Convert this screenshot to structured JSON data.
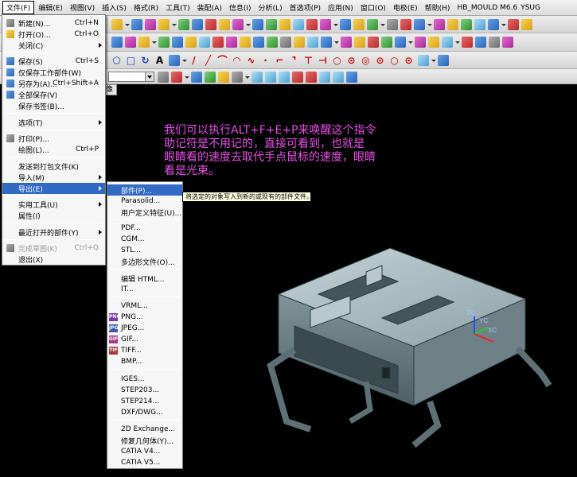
{
  "menubar": {
    "items": [
      "文件(F)",
      "编辑(E)",
      "视图(V)",
      "插入(S)",
      "格式(R)",
      "工具(T)",
      "装配(A)",
      "信息(I)",
      "分析(L)",
      "首选项(P)",
      "应用(N)",
      "窗口(O)",
      "电极(E)",
      "帮助(H)"
    ],
    "brand": "HB_MOULD M6.6",
    "brand2": "YSUG"
  },
  "viewport_tab": "像",
  "file_menu": {
    "items": [
      {
        "label": "新建(N)...",
        "shortcut": "Ctrl+N",
        "icon": "new-file-icon"
      },
      {
        "label": "打开(O)...",
        "shortcut": "Ctrl+O",
        "icon": "open-folder-icon"
      },
      {
        "label": "关闭(C)",
        "shortcut": "",
        "icon": ""
      },
      {
        "label": "保存(S)",
        "shortcut": "Ctrl+S",
        "icon": "save-icon"
      },
      {
        "label": "仅保存工作部件(W)",
        "shortcut": "",
        "icon": "save-work-part-icon"
      },
      {
        "label": "另存为(A)...",
        "shortcut": "Ctrl+Shift+A",
        "icon": "save-as-icon"
      },
      {
        "label": "全部保存(V)",
        "shortcut": "",
        "icon": "save-all-icon"
      },
      {
        "label": "保存书签(B)...",
        "shortcut": "",
        "icon": ""
      },
      {
        "label": "选项(T)",
        "shortcut": "",
        "icon": ""
      },
      {
        "label": "打印(P)...",
        "shortcut": "",
        "icon": "print-icon"
      },
      {
        "label": "绘图(L)...",
        "shortcut": "Ctrl+P",
        "icon": ""
      },
      {
        "label": "发送到打包文件(K)",
        "shortcut": "",
        "icon": ""
      },
      {
        "label": "导入(M)",
        "shortcut": "",
        "icon": ""
      },
      {
        "label": "导出(E)",
        "shortcut": "",
        "icon": ""
      },
      {
        "label": "实用工具(U)",
        "shortcut": "",
        "icon": ""
      },
      {
        "label": "属性(I)",
        "shortcut": "",
        "icon": ""
      },
      {
        "label": "最近打开的部件(Y)",
        "shortcut": "",
        "icon": ""
      },
      {
        "label": "完成草图(K)",
        "shortcut": "Ctrl+Q",
        "icon": "finish-sketch-icon"
      },
      {
        "label": "退出(X)",
        "shortcut": "",
        "icon": ""
      }
    ]
  },
  "export_menu": {
    "items": [
      {
        "label": "部件(P)..."
      },
      {
        "label": "Parasolid..."
      },
      {
        "label": "用户定义特征(U)..."
      },
      {
        "label": "PDF..."
      },
      {
        "label": "CGM..."
      },
      {
        "label": "STL..."
      },
      {
        "label": "多边形文件(O)..."
      },
      {
        "label": "编辑 HTML..."
      },
      {
        "label": "IT..."
      },
      {
        "label": "VRML..."
      },
      {
        "label": "PNG..."
      },
      {
        "label": "JPEG..."
      },
      {
        "label": "GIF..."
      },
      {
        "label": "TIFF..."
      },
      {
        "label": "BMP..."
      },
      {
        "label": "IGES..."
      },
      {
        "label": "STEP203..."
      },
      {
        "label": "STEP214..."
      },
      {
        "label": "DXF/DWG..."
      },
      {
        "label": "2D Exchange..."
      },
      {
        "label": "修复几何体(Y)..."
      },
      {
        "label": "CATIA V4..."
      },
      {
        "label": "CATIA V5..."
      }
    ]
  },
  "tooltip": "将选定的对象写入到新的或现有的部件文件。",
  "note": {
    "line1": "我们可以执行ALT+F+E+P来唤醒这个指令",
    "line2": "助记符是不用记的，直接可看到，也就是",
    "line3": "眼睛看的速度去取代手点鼠标的速度，眼睛",
    "line4": "看是光束。"
  },
  "axis_labels": {
    "zc": "ZC",
    "yc": "YC",
    "xc": "XC"
  },
  "colors": {
    "highlight": "#316ac5",
    "note_text": "#e94ee9",
    "viewport_bg": "#000000"
  }
}
